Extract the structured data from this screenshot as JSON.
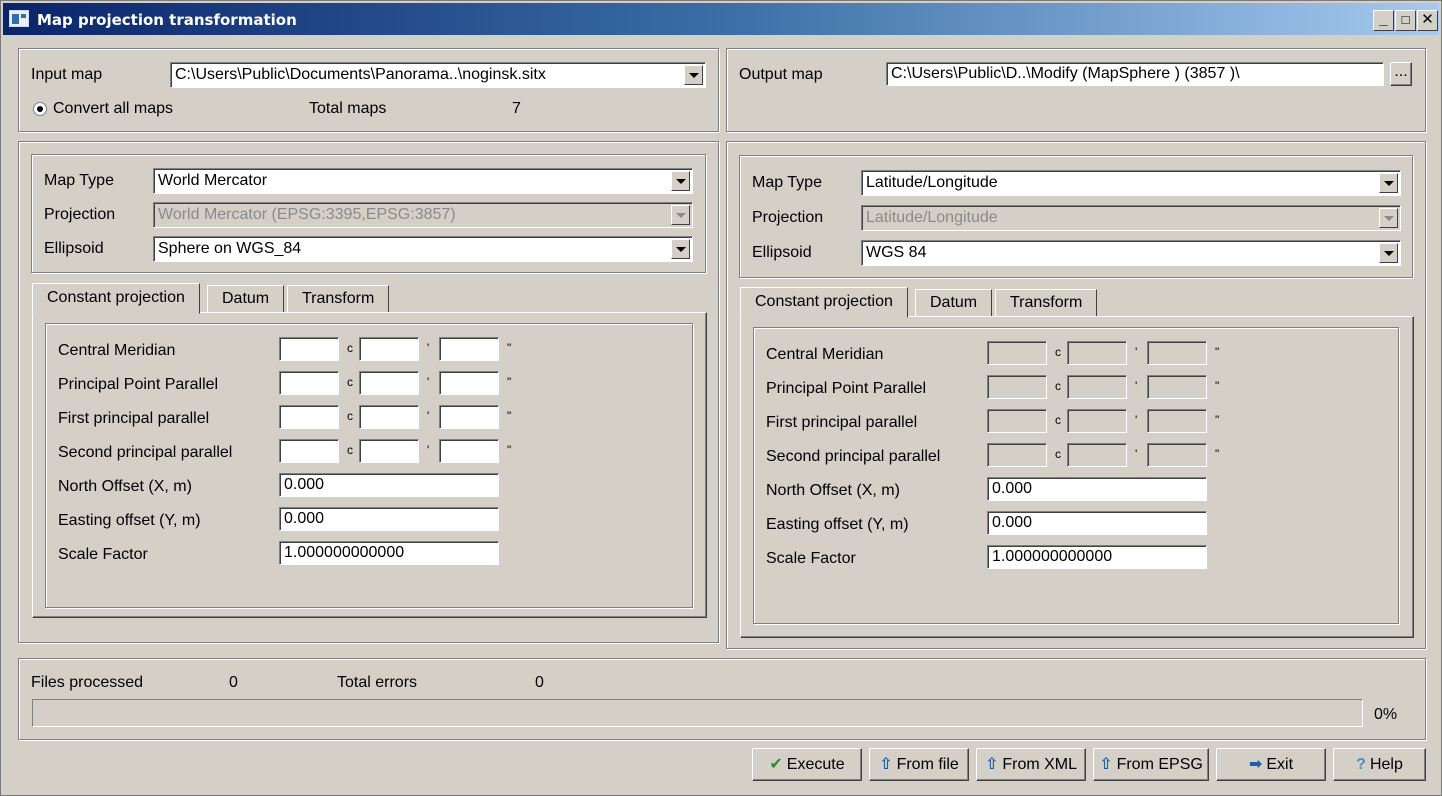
{
  "window": {
    "title": "Map projection transformation",
    "minimize": "_",
    "maximize": "□",
    "close": "✕"
  },
  "input": {
    "label": "Input map",
    "value": "C:\\Users\\Public\\Documents\\Panorama..\\noginsk.sitx",
    "convert_all_label": "Convert all maps",
    "total_maps_label": "Total maps",
    "total_maps_value": "7"
  },
  "output": {
    "label": "Output map",
    "value": "C:\\Users\\Public\\D..\\Modify (MapSphere ) (3857 )\\",
    "browse_label": "..."
  },
  "left": {
    "map_type_label": "Map Type",
    "map_type_value": "World Mercator",
    "projection_label": "Projection",
    "projection_value": "World Mercator (EPSG:3395,EPSG:3857)",
    "ellipsoid_label": "Ellipsoid",
    "ellipsoid_value": "Sphere on WGS_84",
    "tabs": [
      "Constant projection",
      "Datum",
      "Transform"
    ],
    "rows": [
      "Central Meridian",
      "Principal Point Parallel",
      "First principal parallel",
      "Second principal parallel"
    ],
    "north_label": "North Offset (X, m)",
    "north_value": "0.000",
    "east_label": "Easting offset (Y, m)",
    "east_value": "0.000",
    "scale_label": "Scale Factor",
    "scale_value": "1.000000000000"
  },
  "right": {
    "map_type_label": "Map Type",
    "map_type_value": "Latitude/Longitude",
    "projection_label": "Projection",
    "projection_value": "Latitude/Longitude",
    "ellipsoid_label": "Ellipsoid",
    "ellipsoid_value": "WGS 84",
    "tabs": [
      "Constant projection",
      "Datum",
      "Transform"
    ],
    "rows": [
      "Central Meridian",
      "Principal Point Parallel",
      "First principal parallel",
      "Second principal parallel"
    ],
    "north_label": "North Offset (X, m)",
    "north_value": "0.000",
    "east_label": "Easting offset (Y, m)",
    "east_value": "0.000",
    "scale_label": "Scale Factor",
    "scale_value": "1.000000000000"
  },
  "units": {
    "deg": "c",
    "min": "'",
    "sec": "\""
  },
  "status": {
    "files_label": "Files processed",
    "files_value": "0",
    "errors_label": "Total errors",
    "errors_value": "0",
    "progress_text": "0%",
    "progress_fraction": 0
  },
  "buttons": {
    "execute": "Execute",
    "from_file": "From file",
    "from_xml": "From XML",
    "from_epsg": "From EPSG",
    "exit": "Exit",
    "help": "Help"
  },
  "icons": {
    "execute": "✔",
    "from_file": "⇧",
    "from_xml": "⇧",
    "from_epsg": "⇧",
    "exit": "➡",
    "help": "?"
  },
  "colors": {
    "execute_icon": "#2e8b2e",
    "import_icon": "#1f5fa8",
    "help_icon": "#4a90c8"
  }
}
